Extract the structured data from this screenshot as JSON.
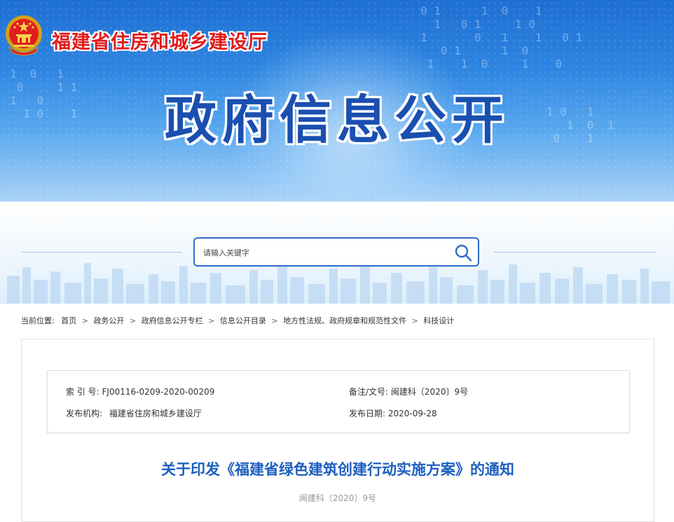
{
  "header": {
    "site_title": "福建省住房和城乡建设厅",
    "banner_title": "政府信息公开"
  },
  "search": {
    "placeholder": "请输入关键字"
  },
  "breadcrumb": {
    "label": "当前位置:",
    "items": [
      "首页",
      "政务公开",
      "政府信息公开专栏",
      "信息公开目录",
      "地方性法规、政府规章和规范性文件",
      "科技设计"
    ]
  },
  "meta": {
    "index_label": "索 引 号:",
    "index_value": "FJ00116-0209-2020-00209",
    "doc_no_label": "备注/文号:",
    "doc_no_value": "闽建科〔2020〕9号",
    "publisher_label": "发布机构:",
    "publisher_value": "福建省住房和城乡建设厅",
    "date_label": "发布日期:",
    "date_value": "2020-09-28"
  },
  "article": {
    "title": "关于印发《福建省绿色建筑创建行动实施方案》的通知",
    "number": "闽建科〔2020〕9号"
  },
  "colors": {
    "brand_red": "#e21b1b",
    "brand_blue": "#1d5fbf",
    "search_border": "#2d6cc8"
  }
}
